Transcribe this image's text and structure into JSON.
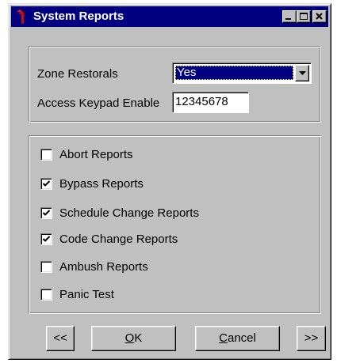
{
  "window": {
    "title": "System Reports",
    "icon": "red-arrow-app-icon",
    "controls": [
      "minimize-icon",
      "maximize-icon",
      "close-icon"
    ]
  },
  "settings": {
    "zone_restorals_label": "Zone Restorals",
    "zone_restorals_value": "Yes",
    "access_keypad_label": "Access Keypad Enable",
    "access_keypad_value": "12345678"
  },
  "reports": [
    {
      "label": "Abort Reports",
      "checked": false
    },
    {
      "label": "Bypass Reports",
      "checked": true
    },
    {
      "label": "Schedule Change Reports",
      "checked": true
    },
    {
      "label": "Code Change Reports",
      "checked": true
    },
    {
      "label": "Ambush Reports",
      "checked": false
    },
    {
      "label": "Panic Test",
      "checked": false
    }
  ],
  "buttons": {
    "prev": "<<",
    "ok": "OK",
    "cancel": "Cancel",
    "next": ">>"
  },
  "colors": {
    "titlebar": "#000080",
    "face": "#c0c0c0",
    "selection": "#000080"
  }
}
